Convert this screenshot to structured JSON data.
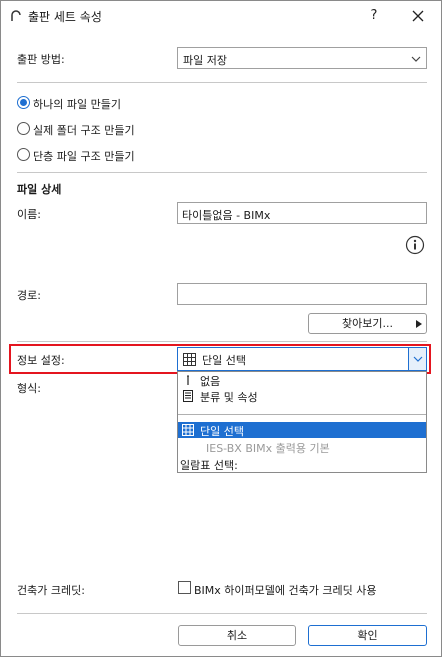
{
  "window": {
    "title": "출판 세트 속성",
    "help_label": "?"
  },
  "publish_method": {
    "label": "출판 방법:",
    "value": "파일 저장"
  },
  "radios": [
    {
      "label": "하나의 파일 만들기",
      "checked": true
    },
    {
      "label": "실제 폴더 구조 만들기",
      "checked": false
    },
    {
      "label": "단층 파일 구조 만들기",
      "checked": false
    }
  ],
  "file_details": {
    "section_title": "파일 상세",
    "name_label": "이름:",
    "name_value": "타이틀없음 - BIMx",
    "path_label": "경로:",
    "path_value": "",
    "browse_label": "찾아보기..."
  },
  "info_settings": {
    "label": "정보 설정:",
    "value": "단일 선택",
    "options": [
      {
        "label": "없음",
        "icon": "cursor-icon",
        "selected": false,
        "dim": false
      },
      {
        "label": "분류 및 속성",
        "icon": "document-icon",
        "selected": false,
        "dim": false
      },
      {
        "label": "단일 선택",
        "icon": "grid-icon",
        "selected": true,
        "dim": false
      },
      {
        "label": "IES-BX BIMx 출력용 기본",
        "icon": "",
        "selected": false,
        "dim": true
      },
      {
        "label": "일람표 선택:",
        "icon": "",
        "selected": false,
        "dim": false
      }
    ]
  },
  "format": {
    "label": "형식:"
  },
  "credit": {
    "label": "건축가 크레딧:",
    "checkbox_label": "BIMx 하이퍼모델에 건축가 크레딧 사용",
    "checked": false
  },
  "footer": {
    "cancel_label": "취소",
    "ok_label": "확인"
  },
  "colors": {
    "accent": "#1e6fd1",
    "highlight": "#e4151f"
  }
}
